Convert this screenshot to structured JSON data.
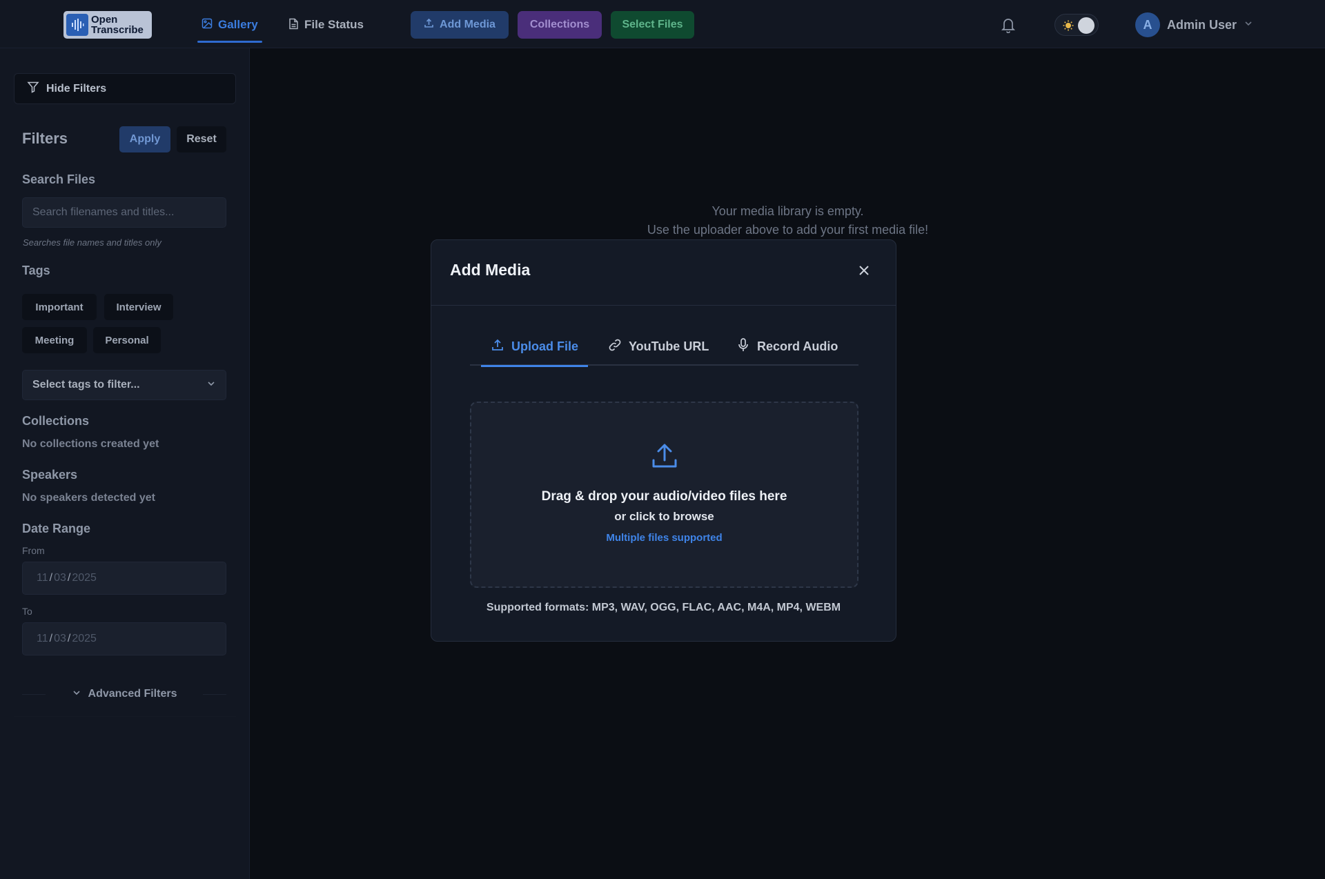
{
  "app": {
    "logo_line1": "Open",
    "logo_line2": "Transcribe"
  },
  "topnav": {
    "tabs": [
      {
        "label": "Gallery",
        "icon": "image-icon",
        "active": true
      },
      {
        "label": "File Status",
        "icon": "file-icon",
        "active": false
      }
    ],
    "buttons": {
      "add_media": "Add Media",
      "collections": "Collections",
      "select_files": "Select Files"
    },
    "user": {
      "avatar_initial": "A",
      "name": "Admin User"
    }
  },
  "sidebar": {
    "hide_filters": "Hide Filters",
    "filters_title": "Filters",
    "apply": "Apply",
    "reset": "Reset",
    "search": {
      "title": "Search Files",
      "placeholder": "Search filenames and titles...",
      "hint": "Searches file names and titles only"
    },
    "tags": {
      "title": "Tags",
      "items": [
        "Important",
        "Interview",
        "Meeting",
        "Personal"
      ],
      "select_placeholder": "Select tags to filter..."
    },
    "collections": {
      "title": "Collections",
      "empty": "No collections created yet"
    },
    "speakers": {
      "title": "Speakers",
      "empty": "No speakers detected yet"
    },
    "date_range": {
      "title": "Date Range",
      "from_label": "From",
      "from": {
        "month": "11",
        "day": "03",
        "year": "2025"
      },
      "to_label": "To",
      "to": {
        "month": "11",
        "day": "03",
        "year": "2025"
      }
    },
    "advanced_filters": "Advanced Filters"
  },
  "main": {
    "empty_line1": "Your media library is empty.",
    "empty_line2": "Use the uploader above to add your first media file!"
  },
  "modal": {
    "title": "Add Media",
    "tabs": [
      {
        "label": "Upload File",
        "icon": "upload-icon",
        "active": true
      },
      {
        "label": "YouTube URL",
        "icon": "link-icon",
        "active": false
      },
      {
        "label": "Record Audio",
        "icon": "microphone-icon",
        "active": false
      }
    ],
    "dropzone": {
      "main": "Drag & drop your audio/video files here",
      "sub": "or click to browse",
      "multi": "Multiple files supported"
    },
    "formats": "Supported formats: MP3, WAV, OGG, FLAC, AAC, M4A, MP4, WEBM"
  },
  "colors": {
    "accent": "#3f84e8",
    "background": "#0b0e14",
    "panel": "#121722",
    "modal": "#141a26"
  }
}
